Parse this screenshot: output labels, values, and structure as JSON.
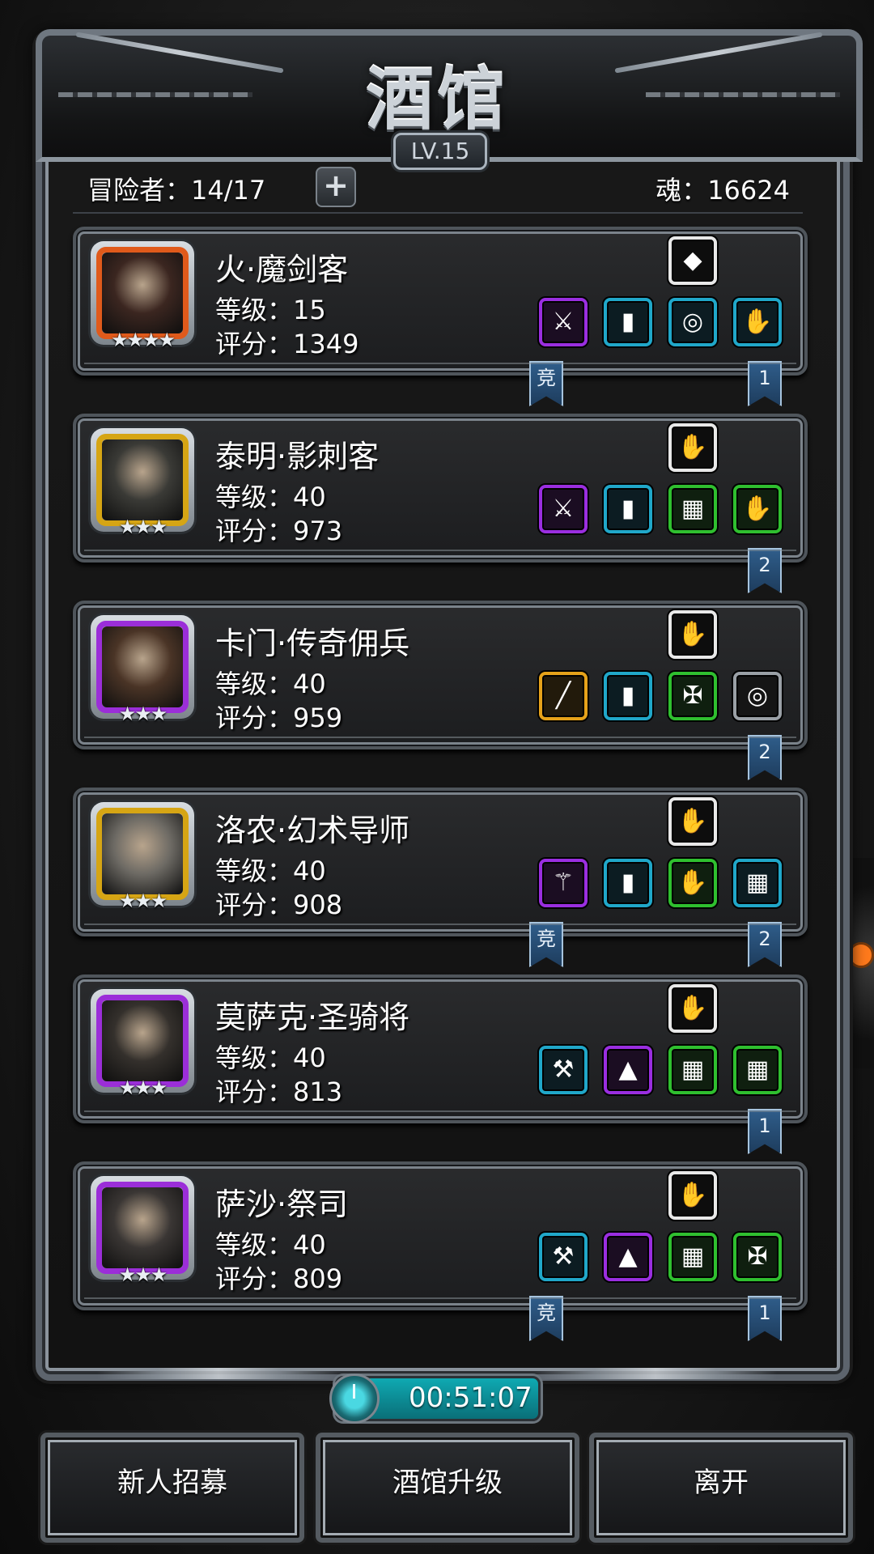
{
  "header": {
    "title": "酒馆",
    "level": "LV.15",
    "adventurers": "冒险者：14/17",
    "plus": "+",
    "soul": "魂：16624"
  },
  "heroes": [
    {
      "name": "火·魔剑客",
      "level": "等级：15",
      "score": "评分：1349",
      "stars": "★★★★",
      "frame": "#e05a1b",
      "face": "#3b2620",
      "special": {
        "color": "white",
        "icon": "crystal-icon",
        "glyph": "◆"
      },
      "items": [
        {
          "color": "purple",
          "icon": "sword-icon",
          "glyph": "⚔"
        },
        {
          "color": "blue",
          "icon": "armor-icon",
          "glyph": "▮"
        },
        {
          "color": "blue",
          "icon": "ring-icon",
          "glyph": "◎"
        },
        {
          "color": "blue",
          "icon": "gauntlet-icon",
          "glyph": "✋"
        }
      ],
      "badges": [
        {
          "text": "竞",
          "pos": "left"
        },
        {
          "text": "1",
          "pos": "right"
        }
      ]
    },
    {
      "name": "泰明·影刺客",
      "level": "等级：40",
      "score": "评分：973",
      "stars": "★★★",
      "frame": "#d6a514",
      "face": "#3a3a36",
      "special": {
        "color": "white",
        "icon": "glove-icon",
        "glyph": "✋"
      },
      "items": [
        {
          "color": "purple",
          "icon": "dagger-icon",
          "glyph": "⚔"
        },
        {
          "color": "blue",
          "icon": "cloak-icon",
          "glyph": "▮"
        },
        {
          "color": "green",
          "icon": "barrel-armor-icon",
          "glyph": "▦"
        },
        {
          "color": "green",
          "icon": "gauntlet-icon",
          "glyph": "✋"
        }
      ],
      "badges": [
        {
          "text": "2",
          "pos": "right"
        }
      ]
    },
    {
      "name": "卡门·传奇佣兵",
      "level": "等级：40",
      "score": "评分：959",
      "stars": "★★★",
      "frame": "#9b2ed8",
      "face": "#4a3426",
      "special": {
        "color": "white",
        "icon": "glove-icon",
        "glyph": "✋"
      },
      "items": [
        {
          "color": "gold",
          "icon": "rifle-icon",
          "glyph": "╱"
        },
        {
          "color": "blue",
          "icon": "armor-icon",
          "glyph": "▮"
        },
        {
          "color": "green",
          "icon": "amulet-icon",
          "glyph": "✠"
        },
        {
          "color": "grey",
          "icon": "ring-icon",
          "glyph": "◎"
        }
      ],
      "badges": [
        {
          "text": "2",
          "pos": "right"
        }
      ]
    },
    {
      "name": "洛农·幻术导师",
      "level": "等级：40",
      "score": "评分：908",
      "stars": "★★★",
      "frame": "#d6a514",
      "face": "#6d6a64",
      "special": {
        "color": "white",
        "icon": "glove-icon",
        "glyph": "✋"
      },
      "items": [
        {
          "color": "purple",
          "icon": "staff-icon",
          "glyph": "⚚"
        },
        {
          "color": "blue",
          "icon": "cloak-icon",
          "glyph": "▮"
        },
        {
          "color": "green",
          "icon": "gauntlet-icon",
          "glyph": "✋"
        },
        {
          "color": "blue",
          "icon": "barrel-armor-icon",
          "glyph": "▦"
        }
      ],
      "badges": [
        {
          "text": "竞",
          "pos": "left"
        },
        {
          "text": "2",
          "pos": "right"
        }
      ]
    },
    {
      "name": "莫萨克·圣骑将",
      "level": "等级：40",
      "score": "评分：813",
      "stars": "★★★",
      "frame": "#9b2ed8",
      "face": "#34302c",
      "special": {
        "color": "white",
        "icon": "ice-glove-icon",
        "glyph": "✋"
      },
      "items": [
        {
          "color": "blue",
          "icon": "hammer-icon",
          "glyph": "⚒"
        },
        {
          "color": "purple",
          "icon": "robe-icon",
          "glyph": "▲"
        },
        {
          "color": "green",
          "icon": "barrel-armor-icon",
          "glyph": "▦"
        },
        {
          "color": "green",
          "icon": "barrel-armor-icon",
          "glyph": "▦"
        }
      ],
      "badges": [
        {
          "text": "1",
          "pos": "right"
        }
      ]
    },
    {
      "name": "萨沙·祭司",
      "level": "等级：40",
      "score": "评分：809",
      "stars": "★★★",
      "frame": "#9b2ed8",
      "face": "#3a3634",
      "special": {
        "color": "white",
        "icon": "ice-glove-icon",
        "glyph": "✋"
      },
      "items": [
        {
          "color": "blue",
          "icon": "hammer-icon",
          "glyph": "⚒"
        },
        {
          "color": "purple",
          "icon": "robe-icon",
          "glyph": "▲"
        },
        {
          "color": "green",
          "icon": "barrel-armor-icon",
          "glyph": "▦"
        },
        {
          "color": "green",
          "icon": "amulet-icon",
          "glyph": "✠"
        }
      ],
      "badges": [
        {
          "text": "竞",
          "pos": "left"
        },
        {
          "text": "1",
          "pos": "right"
        }
      ]
    }
  ],
  "footer": {
    "timer": "00:51:07",
    "recruit": "新人招募",
    "upgrade": "酒馆升级",
    "leave": "离开"
  }
}
